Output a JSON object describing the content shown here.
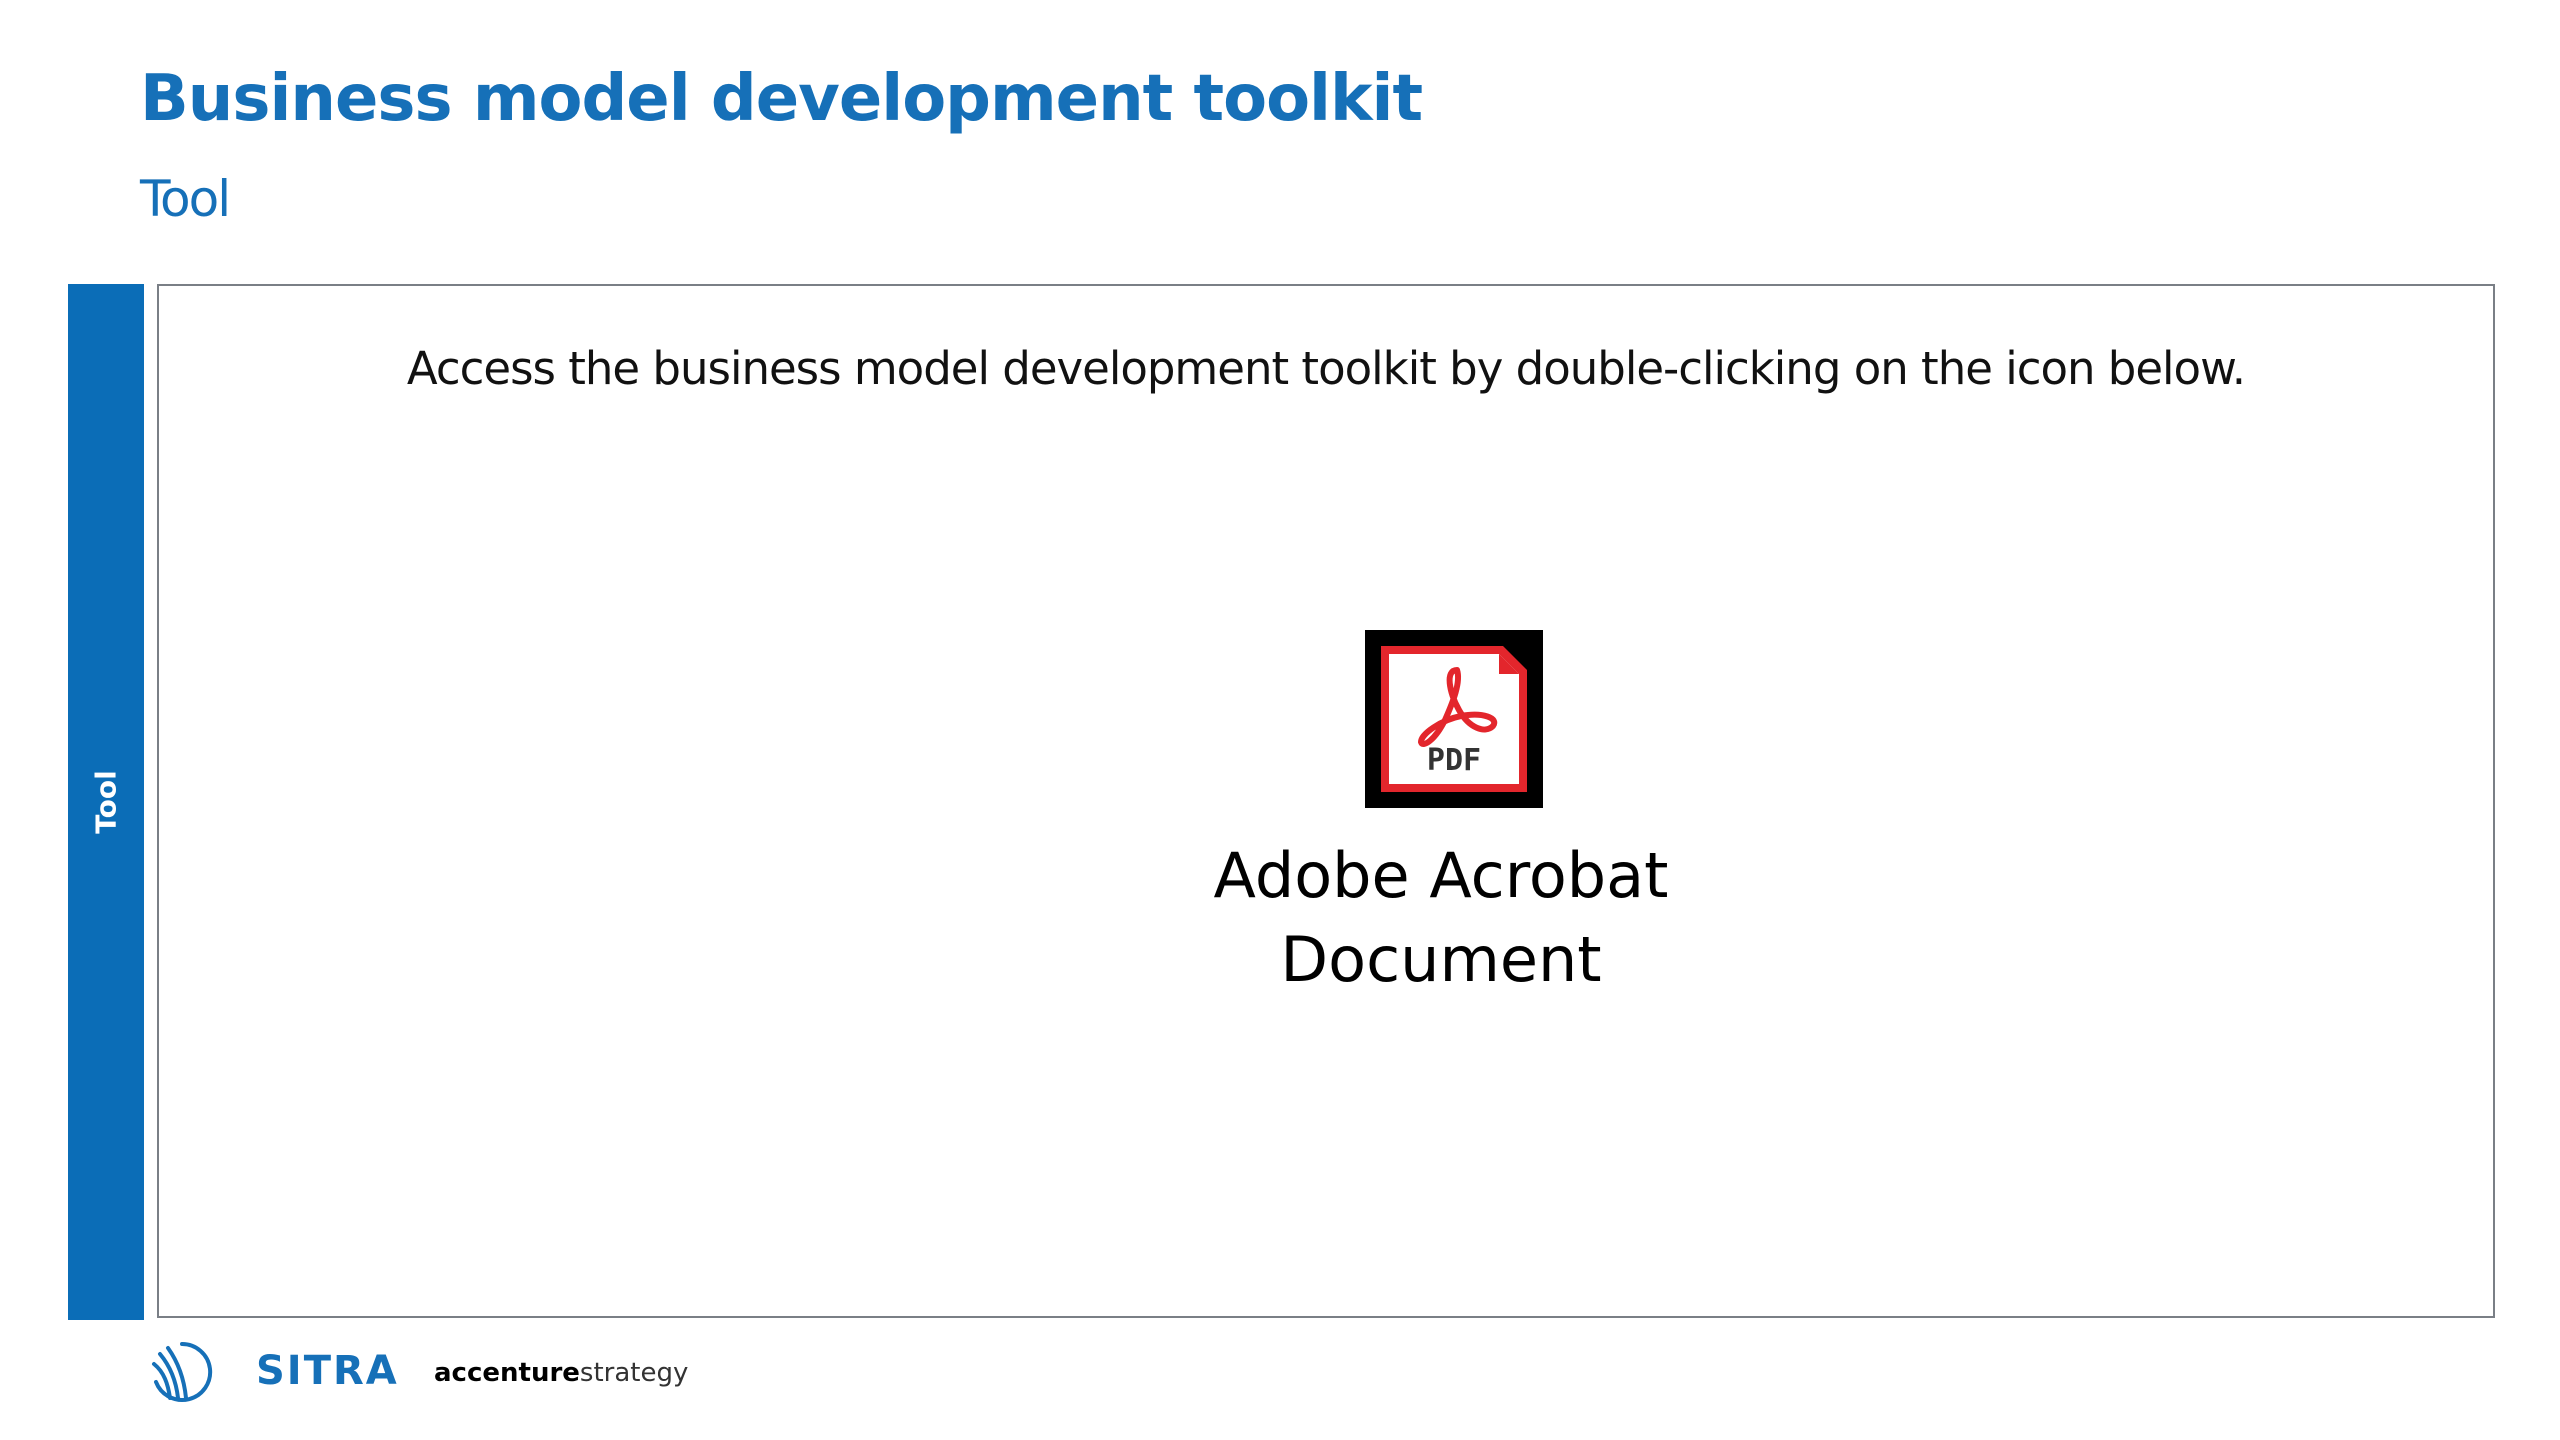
{
  "header": {
    "title": "Business model development toolkit",
    "subtitle": "Tool"
  },
  "side_bar": {
    "label": "Tool",
    "color": "#0b6db7"
  },
  "content": {
    "instruction": "Access the business model development toolkit by double-clicking on the icon below.",
    "attachment": {
      "icon": "pdf-file-icon",
      "icon_text": "PDF",
      "caption_line1": "Adobe Acrobat",
      "caption_line2": "Document"
    }
  },
  "footer": {
    "logo_sitra": "SITRA",
    "logo_accenture_main": "accenture",
    "logo_accenture_sub": "strategy"
  },
  "colors": {
    "brand_blue": "#1670b8",
    "pdf_red": "#e3262c"
  }
}
